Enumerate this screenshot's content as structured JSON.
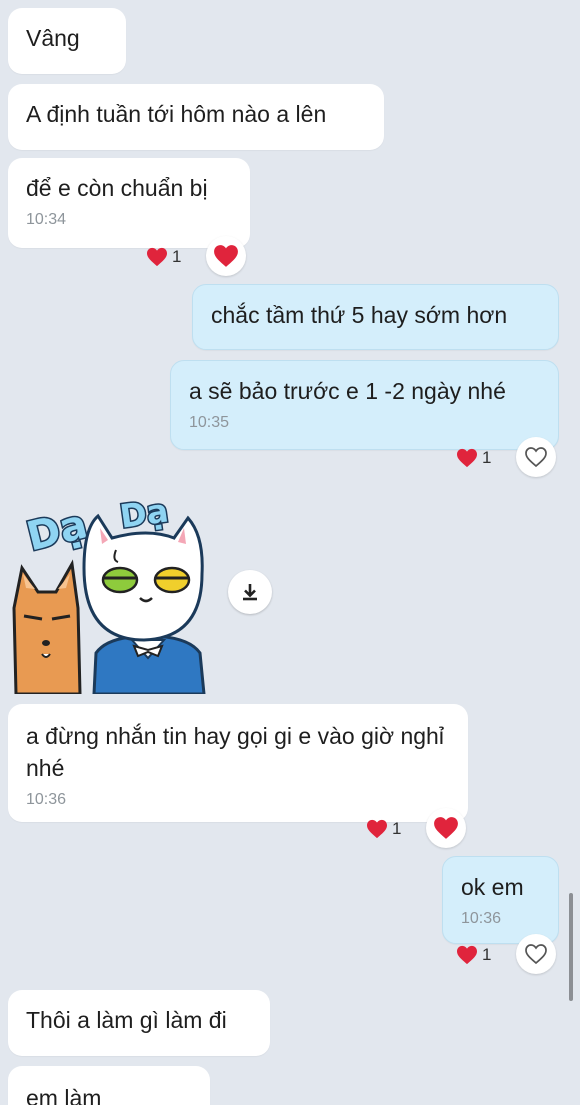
{
  "messages": [
    {
      "text": "Vâng"
    },
    {
      "text": "A định tuần tới hôm nào a lên"
    },
    {
      "text": "để e còn chuẩn bị",
      "time": "10:34",
      "reaction_count": "1"
    },
    {
      "text": "chắc tầm thứ 5 hay sớm hơn"
    },
    {
      "text": "a sẽ bảo trước e 1 -2 ngày nhé",
      "time": "10:35",
      "reaction_count": "1"
    },
    {
      "sticker": {
        "word_left": "Dạ",
        "word_right": "Dạ"
      }
    },
    {
      "text": "a đừng nhắn tin hay gọi gi e vào giờ nghỉ nhé",
      "time": "10:36",
      "reaction_count": "1"
    },
    {
      "text": "ok em",
      "time": "10:36",
      "reaction_count": "1"
    },
    {
      "text": "Thôi a làm gì làm đi"
    },
    {
      "text": "em làm"
    }
  ],
  "icons": {
    "heart": "heart-icon",
    "heart_outline": "heart-outline-icon",
    "download": "download-icon"
  },
  "colors": {
    "background": "#e2e7ee",
    "incoming_bubble": "#ffffff",
    "outgoing_bubble": "#d4eefb",
    "heart": "#e0243c",
    "time": "#8e959b"
  }
}
